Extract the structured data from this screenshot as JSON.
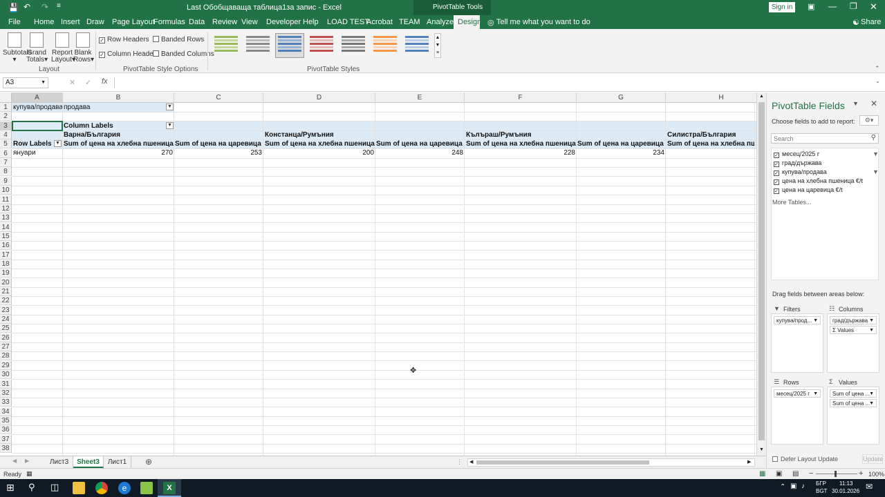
{
  "title_bar": {
    "file_title": "Last Обобщаваща таблица1за запис  -  Excel",
    "context_title": "PivotTable Tools",
    "signin": "Sign in"
  },
  "ribbon_tabs": [
    "File",
    "Home",
    "Insert",
    "Draw",
    "Page Layout",
    "Formulas",
    "Data",
    "Review",
    "View",
    "Developer",
    "Help",
    "LOAD TEST",
    "Acrobat",
    "TEAM",
    "Analyze",
    "Design"
  ],
  "tell_me": "Tell me what you want to do",
  "share": "Share",
  "ribbon": {
    "layout_buttons": [
      "Subtotals",
      "Grand Totals",
      "Report Layout",
      "Blank Rows"
    ],
    "layout_buttons_line1": [
      "Subtotals",
      "Grand",
      "Report",
      "Blank"
    ],
    "layout_buttons_line2": [
      "",
      "Totals",
      "Layout",
      "Rows"
    ],
    "layout_group": "Layout",
    "options": [
      {
        "label": "Row Headers",
        "checked": true
      },
      {
        "label": "Column Headers",
        "checked": true
      },
      {
        "label": "Banded Rows",
        "checked": false
      },
      {
        "label": "Banded Columns",
        "checked": false
      }
    ],
    "options_group": "PivotTable Style Options",
    "styles_group": "PivotTable Styles"
  },
  "formula_bar": {
    "name_box": "A3",
    "fx": "fx",
    "value": ""
  },
  "columns": [
    "A",
    "B",
    "C",
    "D",
    "E",
    "F",
    "G",
    "H"
  ],
  "rows": [
    "1",
    "2",
    "3",
    "4",
    "5",
    "6",
    "7",
    "8",
    "9",
    "10",
    "11",
    "12",
    "13",
    "14",
    "15",
    "16",
    "17",
    "18",
    "19",
    "20",
    "21",
    "22",
    "23",
    "24",
    "25",
    "26",
    "27",
    "28",
    "29",
    "30",
    "31",
    "32",
    "33",
    "34",
    "35",
    "36",
    "37",
    "38"
  ],
  "pivot": {
    "filter_field": "купува/продава",
    "filter_value": "продава",
    "column_labels": "Column Labels",
    "row_labels": "Row Labels",
    "groups": [
      "Варна/България",
      "Констанца/Румъния",
      "Кълъраш/Румъния",
      "Силистра/България"
    ],
    "measures": [
      "Sum of цена на хлебна пшеница €/t",
      "Sum of цена на царевица €/t",
      "Sum of цена на хлебна пшеница €/t",
      "Sum of цена на царевица €/t",
      "Sum of цена на хлебна пшеница €/t",
      "Sum of цена на царевица €/t",
      "Sum of цена на хлебна пшени"
    ],
    "row_item": "януари",
    "values": [
      "270",
      "253",
      "200",
      "248",
      "228",
      "234"
    ]
  },
  "sheet_tabs": [
    "Лист3",
    "Sheet3",
    "Лист1"
  ],
  "active_sheet": "Sheet3",
  "status": {
    "ready": "Ready",
    "zoom": "100%"
  },
  "pane": {
    "title": "PivotTable Fields",
    "subtitle": "Choose fields to add to report:",
    "search_placeholder": "Search",
    "fields": [
      {
        "label": "месец/2025 г",
        "checked": true,
        "filtered": true
      },
      {
        "label": "град/държава",
        "checked": true,
        "filtered": false
      },
      {
        "label": "купува/продава",
        "checked": true,
        "filtered": true
      },
      {
        "label": "цена на хлебна пшеница €/t",
        "checked": true,
        "filtered": false
      },
      {
        "label": "цена на царевица €/t",
        "checked": true,
        "filtered": false
      }
    ],
    "more_tables": "More Tables...",
    "drag_hint": "Drag fields between areas below:",
    "areas": {
      "filters": {
        "label": "Filters",
        "items": [
          "купува/прод..."
        ]
      },
      "columns": {
        "label": "Columns",
        "items": [
          "град/държава",
          "Values"
        ]
      },
      "rows": {
        "label": "Rows",
        "items": [
          "месец/2025 г"
        ]
      },
      "values": {
        "label": "Values",
        "items": [
          "Sum of цена ...",
          "Sum of цена ..."
        ]
      }
    },
    "defer": "Defer Layout Update",
    "update": "Update"
  },
  "taskbar": {
    "lang1": "БГР",
    "lang2": "BGT",
    "time": "11:13",
    "date": "30.01.2026"
  },
  "colors": {
    "excel_green": "#217346",
    "pivot_band": "#ddebf7",
    "taskbar": "#101a24"
  }
}
